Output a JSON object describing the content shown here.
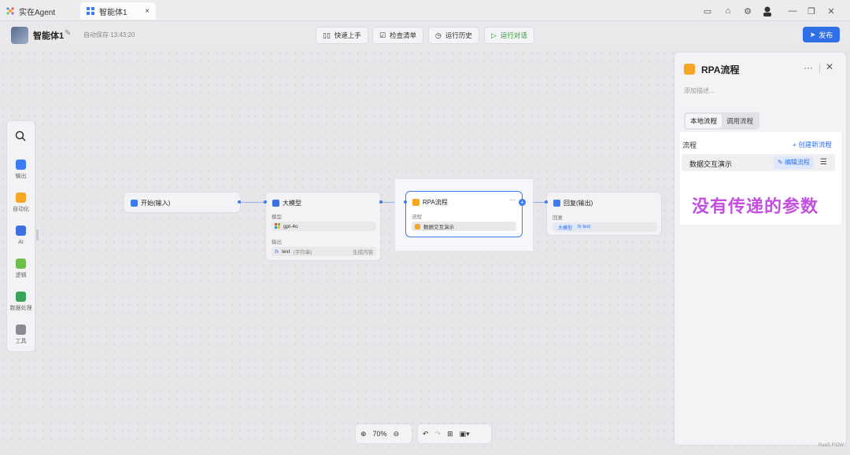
{
  "tabbar": {
    "app_label": "实在Agent",
    "active_tab": "智能体1",
    "close_glyph": "×"
  },
  "header": {
    "agent_name": "智能体1",
    "autosave": "自动保存 13:43:20",
    "quick_start": "快速上手",
    "checklist": "检查清单",
    "run_history": "运行历史",
    "run_dialog": "运行对话",
    "publish": "发布"
  },
  "toolbar": {
    "items": [
      {
        "label": "输出",
        "color": "#3d7bf0"
      },
      {
        "label": "自动化",
        "color": "#f5a623"
      },
      {
        "label": "AI",
        "color": "#3d6fe0"
      },
      {
        "label": "逻辑",
        "color": "#6cc04a"
      },
      {
        "label": "数据处理",
        "color": "#3aa35a"
      },
      {
        "label": "工具",
        "color": "#8a8a92"
      }
    ]
  },
  "nodes": {
    "start": {
      "title": "开始(输入)"
    },
    "llm": {
      "title": "大模型",
      "model_label": "模型",
      "model_value": "gpt-4o",
      "output_label": "输出",
      "output_var": "text",
      "output_type": "(字符串)",
      "output_desc": "生成内容"
    },
    "rpa": {
      "title": "RPA流程",
      "flow_label": "流程",
      "flow_value": "数据交互演示",
      "more": "···"
    },
    "reply": {
      "title": "回复(输出)",
      "reply_label": "回复",
      "tag1": "大模型",
      "tag2": "text"
    }
  },
  "bottom": {
    "zoom": "70%"
  },
  "panel": {
    "title": "RPA流程",
    "more": "···",
    "close": "✕",
    "description_placeholder": "添加描述...",
    "tabs": [
      "本地流程",
      "调用流程"
    ],
    "flow_label": "流程",
    "create_flow": "+ 创建新流程",
    "flow_name": "数据交互演示",
    "edit_flow": "编辑流程",
    "annotation": "没有传递的参数"
  },
  "watermark": "RaaS FlOW"
}
